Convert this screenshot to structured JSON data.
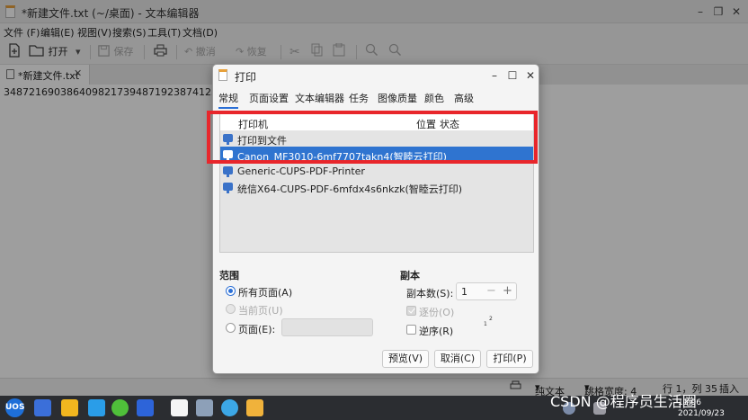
{
  "window": {
    "title": "*新建文件.txt (~/桌面) - 文本编辑器",
    "controls": [
      "–",
      "❐",
      "✕"
    ]
  },
  "menu": {
    "items": [
      "文件 (F)",
      "编辑(E)",
      "视图(V)",
      "搜索(S)",
      "工具(T)",
      "文档(D)"
    ]
  },
  "toolbar": {
    "open_label": "打开",
    "save_label": "保存",
    "undo_label": "撤消",
    "redo_label": "恢复"
  },
  "tab": {
    "label": "*新建文件.txt",
    "close": "✕"
  },
  "editor": {
    "text": "3487216903864098217394871923874123"
  },
  "statusbar": {
    "mode": "纯文本",
    "tab_width": "跳格宽度: 4",
    "position": "行 1，列 35",
    "insert": "插入"
  },
  "dialog": {
    "title": "打印",
    "tabs": [
      "常规",
      "页面设置",
      "文本编辑器",
      "任务",
      "图像质量",
      "颜色",
      "高级"
    ],
    "printer_list": {
      "headers": {
        "printer": "打印机",
        "location": "位置",
        "status": "状态"
      },
      "rows": [
        {
          "name": "打印到文件",
          "selected": false
        },
        {
          "name": "Canon_MF3010-6mf7707takn4(智睦云打印)",
          "selected": true
        },
        {
          "name": "Generic-CUPS-PDF-Printer",
          "selected": false
        },
        {
          "name": "统信X64-CUPS-PDF-6mfdx4s6nkzk(智睦云打印)",
          "selected": false
        }
      ]
    },
    "range": {
      "heading": "范围",
      "all_pages": "所有页面(A)",
      "current_page": "当前页(U)",
      "pages": "页面(E):"
    },
    "copies": {
      "heading": "副本",
      "count_label": "副本数(S):",
      "count_value": "1",
      "collate": "逐份(O)",
      "reverse": "逆序(R)",
      "collate_icon": [
        "1",
        "2"
      ]
    },
    "buttons": {
      "preview": "预览(V)",
      "cancel": "取消(C)",
      "print": "打印(P)"
    }
  },
  "taskbar": {
    "start": "UOS",
    "clock_time": "11:06",
    "clock_date": "2021/09/23"
  },
  "watermark": "CSDN @程序员生活圈",
  "colors": {
    "selection": "#2f74d0",
    "highlight_box": "#e8262b",
    "accent": "#2b6fd6",
    "taskbar": "#2b2d31"
  }
}
